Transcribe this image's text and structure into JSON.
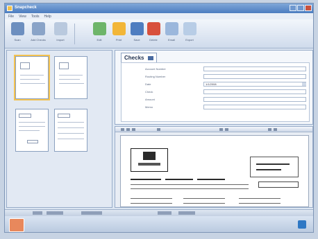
{
  "window": {
    "title": "Snapcheck"
  },
  "menubar": {
    "items": [
      "File",
      "View",
      "Tools",
      "Help"
    ]
  },
  "toolbar": {
    "buttons": [
      {
        "label": "Scan",
        "icon": "scanner-icon",
        "color": "#6d8fbf"
      },
      {
        "label": "Add Checks",
        "icon": "add-checks-icon",
        "color": "#8aa4c8"
      },
      {
        "label": "Import",
        "icon": "import-icon",
        "color": "#b9c9de"
      },
      {
        "label": "Edit",
        "icon": "edit-icon",
        "color": "#6eb56a"
      },
      {
        "label": "Print",
        "icon": "print-icon",
        "color": "#f2b638"
      },
      {
        "label": "Save",
        "icon": "save-icon",
        "color": "#4e7dc0"
      },
      {
        "label": "Delete",
        "icon": "delete-icon",
        "color": "#d8503d"
      },
      {
        "label": "Email",
        "icon": "email-icon",
        "color": "#9bb7dc"
      },
      {
        "label": "Export",
        "icon": "export-icon",
        "color": "#b8cde6"
      }
    ]
  },
  "checks_panel": {
    "title": "Checks",
    "fields": [
      {
        "label": "Account Number",
        "value": ""
      },
      {
        "label": "Routing Number",
        "value": ""
      },
      {
        "label": "Date",
        "value": "1/1/2008"
      },
      {
        "label": "Check",
        "value": ""
      },
      {
        "label": "Amount",
        "value": ""
      },
      {
        "label": "Memo",
        "value": ""
      }
    ]
  },
  "thumbnails": [
    {
      "caption": ""
    },
    {
      "caption": ""
    },
    {
      "caption": ""
    },
    {
      "caption": ""
    }
  ],
  "preview": {
    "address_lines": [
      "Snapcheck Services",
      "2008 Main Street"
    ],
    "date_label": "Date",
    "date_value": "1/1/08"
  },
  "colors": {
    "accent": "#4b7cc0",
    "selection": "#f4c24f",
    "close": "#c9523e"
  }
}
